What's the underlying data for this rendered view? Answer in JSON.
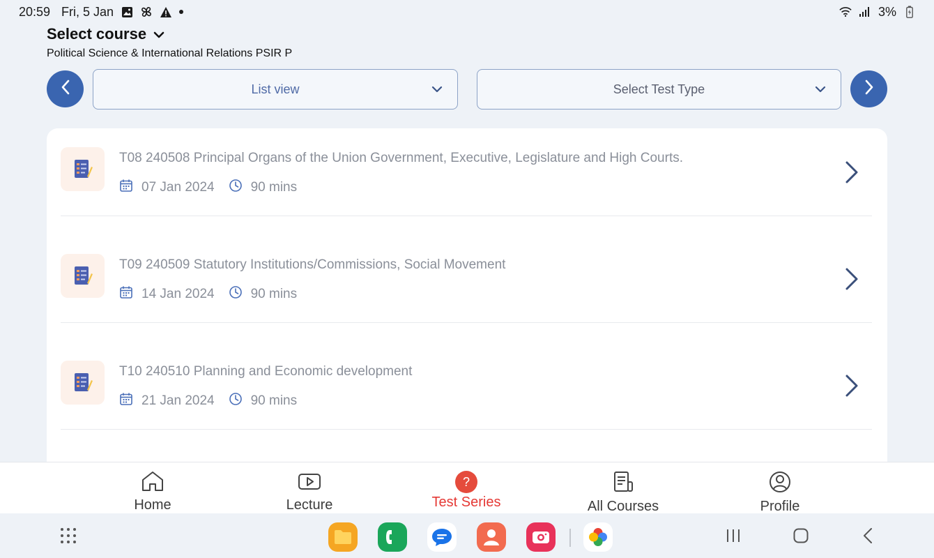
{
  "status_bar": {
    "time": "20:59",
    "date": "Fri, 5 Jan",
    "battery": "3%",
    "icons": [
      "gallery-icon",
      "pinwheel-icon",
      "warning-icon",
      "dot-icon",
      "wifi-icon",
      "signal-icon",
      "battery-icon"
    ]
  },
  "header": {
    "course_select_label": "Select course",
    "course_name": "Political Science & International Relations PSIR P"
  },
  "filters": {
    "view_label": "List view",
    "test_type_label": "Select Test Type"
  },
  "tests": [
    {
      "title": "T08 240508 Principal Organs of the Union Government, Executive, Legislature and High Courts.",
      "date": "07 Jan 2024",
      "duration": "90 mins"
    },
    {
      "title": "T09 240509 Statutory Institutions/Commissions, Social Movement",
      "date": "14 Jan 2024",
      "duration": "90 mins"
    },
    {
      "title": "T10 240510 Planning and Economic development",
      "date": "21 Jan 2024",
      "duration": "90 mins"
    }
  ],
  "bottom_nav": {
    "home": "Home",
    "lecture": "Lecture",
    "test_series": "Test Series",
    "all_courses": "All Courses",
    "profile": "Profile",
    "active": "test_series",
    "test_series_icon_glyph": "?"
  },
  "colors": {
    "accent": "#3a65b0",
    "active_tab": "#e53935",
    "muted_text": "#8a8f99"
  }
}
